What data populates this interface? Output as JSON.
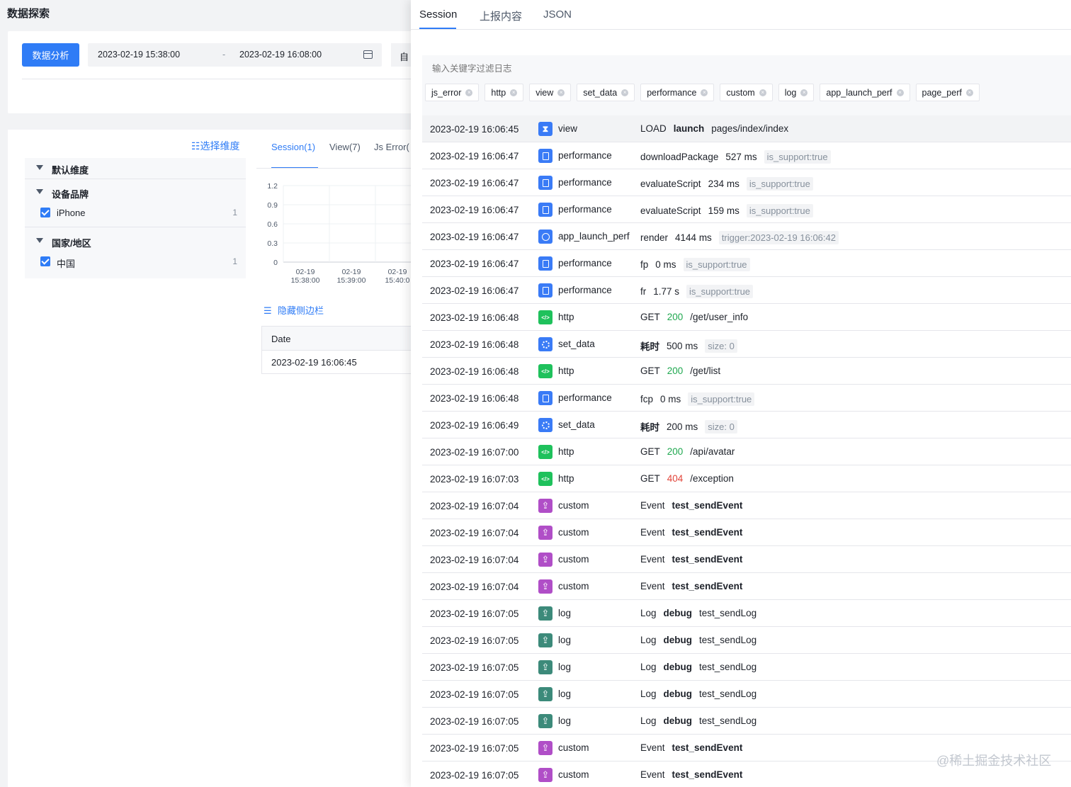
{
  "page": {
    "title": "数据探索",
    "analyze_button": "数据分析",
    "range_start": "2023-02-19 15:38:00",
    "range_sep": "-",
    "range_end": "2023-02-19 16:08:00",
    "custom_label": "自"
  },
  "dimensions": {
    "select_link": "☷选择维度",
    "groups": [
      {
        "label": "默认维度",
        "items": []
      },
      {
        "label": "设备品牌",
        "items": [
          {
            "label": "iPhone",
            "count": "1"
          }
        ]
      },
      {
        "label": "国家/地区",
        "items": [
          {
            "label": "中国",
            "count": "1"
          }
        ]
      }
    ]
  },
  "sub_tabs": [
    "Session(1)",
    "View(7)",
    "Js Error("
  ],
  "chart_data": {
    "type": "line",
    "categories": [
      "02-19 15:38:00",
      "02-19 15:39:00",
      "02-19 15:40:00"
    ],
    "ylim": [
      0,
      1.2
    ],
    "yticks": [
      "1.2",
      "0.9",
      "0.6",
      "0.3",
      "0"
    ],
    "xtick_dates": [
      "02-19",
      "02-19",
      "02-19"
    ],
    "xtick_times": [
      "15:38:00",
      "15:39:00",
      "15:40:0"
    ],
    "series": [
      {
        "values": [
          0,
          0,
          0
        ]
      }
    ],
    "grid": true
  },
  "hide_sidebar": "隐藏侧边栏",
  "date_table": {
    "header": "Date",
    "value": "2023-02-19 16:06:45"
  },
  "drawer": {
    "tabs": [
      "Session",
      "上报内容",
      "JSON"
    ],
    "search_placeholder": "输入关键字过滤日志",
    "chips": [
      "js_error",
      "http",
      "view",
      "set_data",
      "performance",
      "custom",
      "log",
      "app_launch_perf",
      "page_perf"
    ],
    "rows": [
      {
        "time": "2023-02-19 16:06:45",
        "icon": "hourglass-icon",
        "color": "blue",
        "type": "view",
        "parts": [
          {
            "t": "LOAD"
          },
          {
            "t": "launch",
            "s": "b"
          },
          {
            "t": "pages/index/index"
          }
        ]
      },
      {
        "time": "2023-02-19 16:06:47",
        "icon": "document-icon",
        "color": "blue",
        "type": "performance",
        "parts": [
          {
            "t": "downloadPackage"
          },
          {
            "t": "527 ms"
          },
          {
            "t": "is_support:true",
            "s": "tag"
          }
        ]
      },
      {
        "time": "2023-02-19 16:06:47",
        "icon": "document-icon",
        "color": "blue",
        "type": "performance",
        "parts": [
          {
            "t": "evaluateScript"
          },
          {
            "t": "234 ms"
          },
          {
            "t": "is_support:true",
            "s": "tag"
          }
        ]
      },
      {
        "time": "2023-02-19 16:06:47",
        "icon": "document-icon",
        "color": "blue",
        "type": "performance",
        "parts": [
          {
            "t": "evaluateScript"
          },
          {
            "t": "159 ms"
          },
          {
            "t": "is_support:true",
            "s": "tag"
          }
        ]
      },
      {
        "time": "2023-02-19 16:06:47",
        "icon": "play-circle-icon",
        "color": "blue",
        "type": "app_launch_perf",
        "parts": [
          {
            "t": "render"
          },
          {
            "t": "4144 ms"
          },
          {
            "t": "trigger:2023-02-19 16:06:42",
            "s": "tag"
          }
        ]
      },
      {
        "time": "2023-02-19 16:06:47",
        "icon": "document-icon",
        "color": "blue",
        "type": "performance",
        "parts": [
          {
            "t": "fp"
          },
          {
            "t": "0 ms"
          },
          {
            "t": "is_support:true",
            "s": "tag"
          }
        ]
      },
      {
        "time": "2023-02-19 16:06:47",
        "icon": "document-icon",
        "color": "blue",
        "type": "performance",
        "parts": [
          {
            "t": "fr"
          },
          {
            "t": "1.77 s"
          },
          {
            "t": "is_support:true",
            "s": "tag"
          }
        ]
      },
      {
        "time": "2023-02-19 16:06:48",
        "icon": "code-icon",
        "color": "green",
        "type": "http",
        "parts": [
          {
            "t": "GET"
          },
          {
            "t": "200",
            "s": "ok"
          },
          {
            "t": "/get/user_info"
          }
        ]
      },
      {
        "time": "2023-02-19 16:06:48",
        "icon": "loading-icon",
        "color": "blue",
        "type": "set_data",
        "parts": [
          {
            "t": "耗时",
            "s": "b"
          },
          {
            "t": "500 ms"
          },
          {
            "t": "size: 0",
            "s": "tag"
          }
        ]
      },
      {
        "time": "2023-02-19 16:06:48",
        "icon": "code-icon",
        "color": "green",
        "type": "http",
        "parts": [
          {
            "t": "GET"
          },
          {
            "t": "200",
            "s": "ok"
          },
          {
            "t": "/get/list"
          }
        ]
      },
      {
        "time": "2023-02-19 16:06:48",
        "icon": "document-icon",
        "color": "blue",
        "type": "performance",
        "parts": [
          {
            "t": "fcp"
          },
          {
            "t": "0 ms"
          },
          {
            "t": "is_support:true",
            "s": "tag"
          }
        ]
      },
      {
        "time": "2023-02-19 16:06:49",
        "icon": "loading-icon",
        "color": "blue",
        "type": "set_data",
        "parts": [
          {
            "t": "耗时",
            "s": "b"
          },
          {
            "t": "200 ms"
          },
          {
            "t": "size: 0",
            "s": "tag"
          }
        ]
      },
      {
        "time": "2023-02-19 16:07:00",
        "icon": "code-icon",
        "color": "green",
        "type": "http",
        "parts": [
          {
            "t": "GET"
          },
          {
            "t": "200",
            "s": "ok"
          },
          {
            "t": "/api/avatar"
          }
        ]
      },
      {
        "time": "2023-02-19 16:07:03",
        "icon": "code-icon",
        "color": "green",
        "type": "http",
        "parts": [
          {
            "t": "GET"
          },
          {
            "t": "404",
            "s": "err"
          },
          {
            "t": "/exception"
          }
        ]
      },
      {
        "time": "2023-02-19 16:07:04",
        "icon": "upload-icon",
        "color": "purple",
        "type": "custom",
        "parts": [
          {
            "t": "Event"
          },
          {
            "t": "test_sendEvent",
            "s": "b"
          }
        ]
      },
      {
        "time": "2023-02-19 16:07:04",
        "icon": "upload-icon",
        "color": "purple",
        "type": "custom",
        "parts": [
          {
            "t": "Event"
          },
          {
            "t": "test_sendEvent",
            "s": "b"
          }
        ]
      },
      {
        "time": "2023-02-19 16:07:04",
        "icon": "upload-icon",
        "color": "purple",
        "type": "custom",
        "parts": [
          {
            "t": "Event"
          },
          {
            "t": "test_sendEvent",
            "s": "b"
          }
        ]
      },
      {
        "time": "2023-02-19 16:07:04",
        "icon": "upload-icon",
        "color": "purple",
        "type": "custom",
        "parts": [
          {
            "t": "Event"
          },
          {
            "t": "test_sendEvent",
            "s": "b"
          }
        ]
      },
      {
        "time": "2023-02-19 16:07:05",
        "icon": "upload-icon",
        "color": "teal",
        "type": "log",
        "parts": [
          {
            "t": "Log"
          },
          {
            "t": "debug",
            "s": "b"
          },
          {
            "t": "test_sendLog"
          }
        ]
      },
      {
        "time": "2023-02-19 16:07:05",
        "icon": "upload-icon",
        "color": "teal",
        "type": "log",
        "parts": [
          {
            "t": "Log"
          },
          {
            "t": "debug",
            "s": "b"
          },
          {
            "t": "test_sendLog"
          }
        ]
      },
      {
        "time": "2023-02-19 16:07:05",
        "icon": "upload-icon",
        "color": "teal",
        "type": "log",
        "parts": [
          {
            "t": "Log"
          },
          {
            "t": "debug",
            "s": "b"
          },
          {
            "t": "test_sendLog"
          }
        ]
      },
      {
        "time": "2023-02-19 16:07:05",
        "icon": "upload-icon",
        "color": "teal",
        "type": "log",
        "parts": [
          {
            "t": "Log"
          },
          {
            "t": "debug",
            "s": "b"
          },
          {
            "t": "test_sendLog"
          }
        ]
      },
      {
        "time": "2023-02-19 16:07:05",
        "icon": "upload-icon",
        "color": "teal",
        "type": "log",
        "parts": [
          {
            "t": "Log"
          },
          {
            "t": "debug",
            "s": "b"
          },
          {
            "t": "test_sendLog"
          }
        ]
      },
      {
        "time": "2023-02-19 16:07:05",
        "icon": "upload-icon",
        "color": "purple",
        "type": "custom",
        "parts": [
          {
            "t": "Event"
          },
          {
            "t": "test_sendEvent",
            "s": "b"
          }
        ]
      },
      {
        "time": "2023-02-19 16:07:05",
        "icon": "upload-icon",
        "color": "purple",
        "type": "custom",
        "parts": [
          {
            "t": "Event"
          },
          {
            "t": "test_sendEvent",
            "s": "b"
          }
        ]
      }
    ]
  },
  "watermark": "@稀土掘金技术社区",
  "colors": {
    "primary": "#2f7cf6",
    "success": "#1fa84f",
    "error": "#e2453a",
    "custom": "#b04ec7",
    "log": "#3c8a7a"
  }
}
